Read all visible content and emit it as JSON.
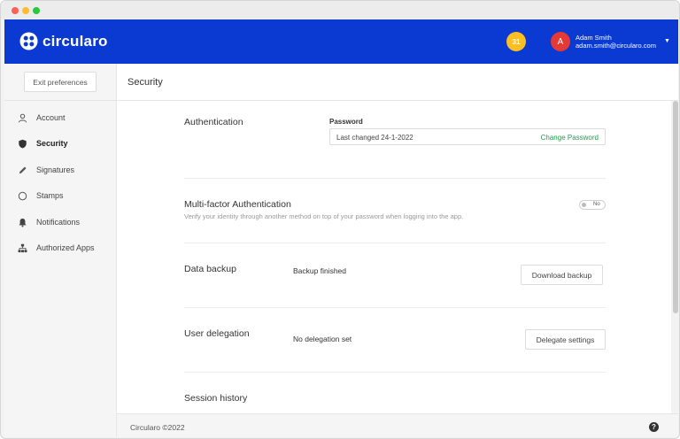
{
  "app": {
    "brand": "circularo",
    "notification_count": "31",
    "user": {
      "initial": "A",
      "name": "Adam Smith",
      "email": "adam.smith@circularo.com"
    },
    "colors": {
      "header": "#0b3ad3",
      "badge": "#fbbf24",
      "avatar": "#e53935",
      "link": "#1e9e4a"
    }
  },
  "sidebar": {
    "exit_label": "Exit preferences",
    "items": [
      {
        "label": "Account",
        "icon": "user-icon"
      },
      {
        "label": "Security",
        "icon": "shield-icon"
      },
      {
        "label": "Signatures",
        "icon": "pen-icon"
      },
      {
        "label": "Stamps",
        "icon": "stamp-icon"
      },
      {
        "label": "Notifications",
        "icon": "bell-icon"
      },
      {
        "label": "Authorized Apps",
        "icon": "apps-icon"
      }
    ],
    "active": "Security"
  },
  "page": {
    "title": "Security"
  },
  "sections": {
    "authentication": {
      "title": "Authentication",
      "password_label": "Password",
      "password_value": "Last changed 24-1-2022",
      "change_link": "Change Password"
    },
    "mfa": {
      "title": "Multi-factor Authentication",
      "description": "Verify your identity through another method on top of your password when logging into the app.",
      "toggle_label": "No"
    },
    "backup": {
      "title": "Data backup",
      "status": "Backup finished",
      "button": "Download backup"
    },
    "delegation": {
      "title": "User delegation",
      "status": "No delegation set",
      "button": "Delegate settings"
    },
    "session": {
      "title": "Session history"
    }
  },
  "footer": {
    "text": "Circularo ©2022",
    "help": "?"
  }
}
